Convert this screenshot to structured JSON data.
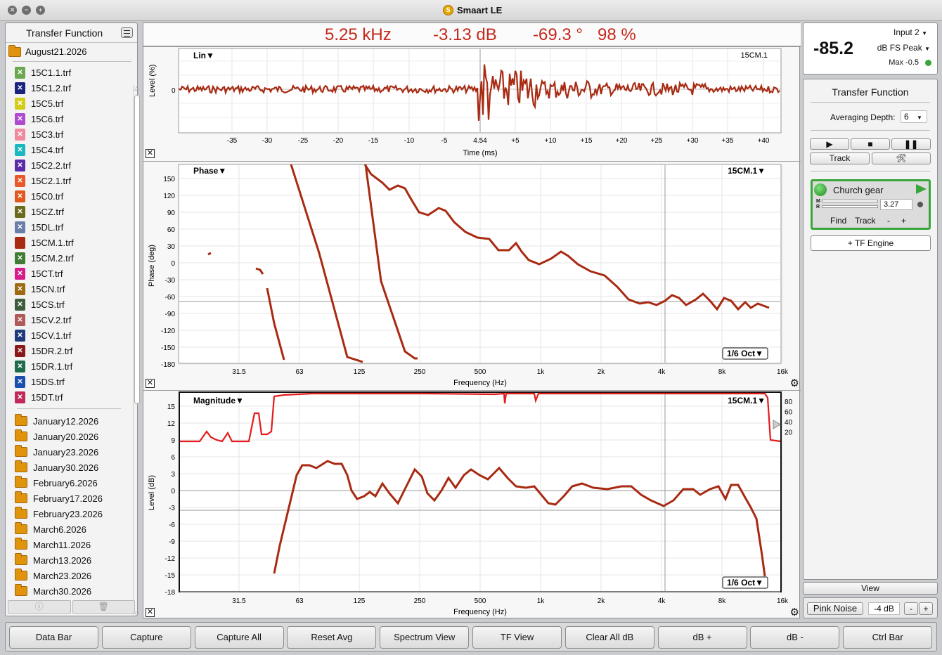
{
  "window": {
    "title": "Smaart LE",
    "logo": "S"
  },
  "left": {
    "header": "Transfer Function",
    "open_folder": "August21.2026",
    "files": [
      {
        "name": "15C1.1.trf",
        "color": "#6aa84f",
        "icon": "x"
      },
      {
        "name": "15C1.2.trf",
        "color": "#1a237e",
        "icon": "x"
      },
      {
        "name": "15C5.trf",
        "color": "#d4cc1a",
        "icon": "x"
      },
      {
        "name": "15C6.trf",
        "color": "#b04bd0",
        "icon": "x"
      },
      {
        "name": "15C3.trf",
        "color": "#ef8a9e",
        "icon": "x"
      },
      {
        "name": "15C4.trf",
        "color": "#1bb8c0",
        "icon": "x"
      },
      {
        "name": "15C2.2.trf",
        "color": "#5b2ca8",
        "icon": "x"
      },
      {
        "name": "15C2.1.trf",
        "color": "#e8582a",
        "icon": "x"
      },
      {
        "name": "15C0.trf",
        "color": "#e05a20",
        "icon": "x"
      },
      {
        "name": "15CZ.trf",
        "color": "#6b6b1e",
        "icon": "x"
      },
      {
        "name": "15DL.trf",
        "color": "#6a7fa8",
        "icon": "x"
      },
      {
        "name": "15CM.1.trf",
        "color": "#a82a12",
        "icon": "doc"
      },
      {
        "name": "15CM.2.trf",
        "color": "#3e7d33",
        "icon": "x"
      },
      {
        "name": "15CT.trf",
        "color": "#d81b8a",
        "icon": "x"
      },
      {
        "name": "15CN.trf",
        "color": "#9c6b12",
        "icon": "x"
      },
      {
        "name": "15CS.trf",
        "color": "#3d5e3d",
        "icon": "x"
      },
      {
        "name": "15CV.2.trf",
        "color": "#b05a5a",
        "icon": "x"
      },
      {
        "name": "15CV.1.trf",
        "color": "#1e3a7a",
        "icon": "x"
      },
      {
        "name": "15DR.2.trf",
        "color": "#8a1a1a",
        "icon": "x"
      },
      {
        "name": "15DR.1.trf",
        "color": "#1e6a4a",
        "icon": "x"
      },
      {
        "name": "15DS.trf",
        "color": "#1a4fb0",
        "icon": "x"
      },
      {
        "name": "15DT.trf",
        "color": "#c02a5a",
        "icon": "x"
      }
    ],
    "folders": [
      "January12.2026",
      "January20.2026",
      "January23.2026",
      "January30.2026",
      "February6.2026",
      "February17.2026",
      "February23.2026",
      "March6.2026",
      "March11.2026",
      "March13.2026",
      "March23.2026",
      "March30.2026"
    ],
    "footer_icons": [
      "info-icon",
      "trash-icon"
    ]
  },
  "readout": {
    "freq": "5.25 kHz",
    "level": "-3.13 dB",
    "phase": "-69.3 °",
    "coherence": "98 %"
  },
  "impulse": {
    "label": "Lin▼",
    "trace": "15CM.1",
    "ylabel": "Level (%)",
    "xlabel": "Time (ms)",
    "ytick": "0",
    "xticks": [
      "-35",
      "-30",
      "-25",
      "-20",
      "-15",
      "-10",
      "-5",
      "4.54",
      "+5",
      "+10",
      "+15",
      "+20",
      "+25",
      "+30",
      "+35",
      "+40"
    ]
  },
  "phase": {
    "label": "Phase▼",
    "trace": "15CM.1▼",
    "ylabel": "Phase (deg)",
    "xlabel": "Frequency (Hz)",
    "smoothing": "1/6 Oct▼",
    "yticks": [
      "150",
      "120",
      "90",
      "60",
      "30",
      "0",
      "-30",
      "-60",
      "-90",
      "-120",
      "-150",
      "-180"
    ],
    "xticks": [
      "31.5",
      "63",
      "125",
      "250",
      "500",
      "1k",
      "2k",
      "4k",
      "8k",
      "16k"
    ]
  },
  "magnitude": {
    "label": "Magnitude▼",
    "trace": "15CM.1▼",
    "ylabel": "Level (dB)",
    "xlabel": "Frequency (Hz)",
    "smoothing": "1/6 Oct▼",
    "yticks": [
      "15",
      "12",
      "9",
      "6",
      "3",
      "0",
      "-3",
      "-6",
      "-9",
      "-12",
      "-15",
      "-18"
    ],
    "xticks": [
      "31.5",
      "63",
      "125",
      "250",
      "500",
      "1k",
      "2k",
      "4k",
      "8k",
      "16k"
    ],
    "coh_ticks": [
      "80",
      "60",
      "40",
      "20"
    ]
  },
  "meter": {
    "value": "-85.2",
    "input": "Input 2",
    "mode": "dB FS Peak",
    "max": "Max -0.5"
  },
  "tf": {
    "title": "Transfer Function",
    "avg_label": "Averaging Depth:",
    "avg_value": "6",
    "track_btn": "Track",
    "engine": {
      "name": "Church gear",
      "delay": "3.27",
      "m": "M",
      "r": "R",
      "find": "Find",
      "track": "Track",
      "minus": "-",
      "plus": "+"
    },
    "add_engine": "+ TF Engine"
  },
  "view_btn": "View",
  "generator": {
    "label": "Pink Noise",
    "level": "-4 dB",
    "minus": "-",
    "plus": "+"
  },
  "bottom": [
    "Data Bar",
    "Capture",
    "Capture All",
    "Reset Avg",
    "Spectrum View",
    "TF View",
    "Clear All dB",
    "dB +",
    "dB -",
    "Ctrl Bar"
  ],
  "colors": {
    "trace": "#a82a12",
    "coherence": "#e31b1b",
    "readout": "#c5281c",
    "accent": "#3aa53a"
  }
}
